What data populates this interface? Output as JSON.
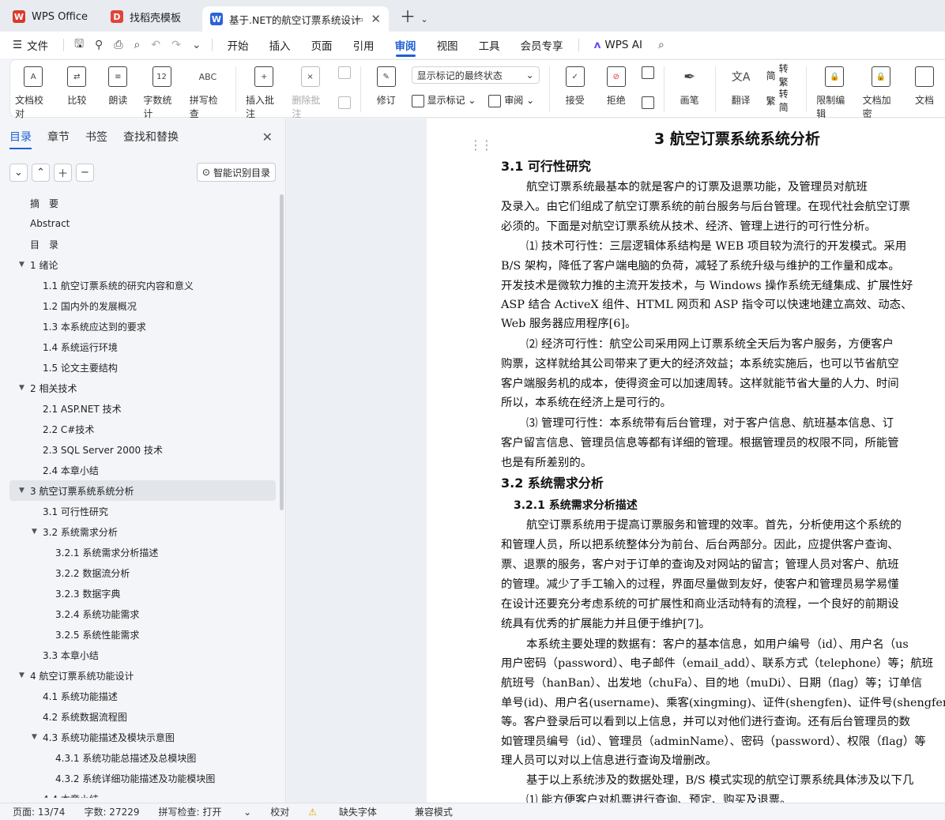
{
  "tabs": [
    {
      "label": "WPS Office",
      "color": "#d93a2b"
    },
    {
      "label": "找稻壳模板",
      "color": "#e0453a"
    },
    {
      "label": "基于.NET的航空订票系统设计",
      "color": "#2b62d9"
    }
  ],
  "menu": {
    "file": "文件",
    "items": [
      "开始",
      "插入",
      "页面",
      "引用",
      "审阅",
      "视图",
      "工具",
      "会员专享"
    ],
    "active": "审阅",
    "ai": "WPS AI"
  },
  "ribbon": {
    "doc_check": "文档校对",
    "compare": "比较",
    "read_aloud": "朗读",
    "word_count": "字数统计",
    "spell_check": "拼写检查",
    "insert_comment": "插入批注",
    "delete_comment": "删除批注",
    "revise": "修订",
    "markup_select": "显示标记的最终状态",
    "show_markup": "显示标记",
    "review": "审阅",
    "accept": "接受",
    "reject": "拒绝",
    "pen": "画笔",
    "translate": "翻译",
    "to_traditional": "转繁",
    "to_simplified": "转简",
    "restrict": "限制编辑",
    "encrypt": "文档加密",
    "doc_more": "文档"
  },
  "nav": {
    "tabs": [
      "目录",
      "章节",
      "书签",
      "查找和替换"
    ],
    "smart_btn": "智能识别目录",
    "toc": [
      {
        "label": "摘　要",
        "level": 0
      },
      {
        "label": "Abstract",
        "level": 0
      },
      {
        "label": "目　录",
        "level": 0
      },
      {
        "label": "1  绪论",
        "level": 0,
        "arrow": true
      },
      {
        "label": "1.1  航空订票系统的研究内容和意义",
        "level": 1
      },
      {
        "label": "1.2  国内外的发展概况",
        "level": 1
      },
      {
        "label": "1.3  本系统应达到的要求",
        "level": 1
      },
      {
        "label": "1.4  系统运行环境",
        "level": 1
      },
      {
        "label": "1.5  论文主要结构",
        "level": 1
      },
      {
        "label": "2  相关技术",
        "level": 0,
        "arrow": true
      },
      {
        "label": "2.1 ASP.NET 技术",
        "level": 1
      },
      {
        "label": "2.2 C#技术",
        "level": 1
      },
      {
        "label": "2.3 SQL Server 2000 技术",
        "level": 1
      },
      {
        "label": "2.4  本章小结",
        "level": 1
      },
      {
        "label": "3  航空订票系统系统分析",
        "level": 0,
        "arrow": true,
        "selected": true
      },
      {
        "label": "3.1  可行性研究",
        "level": 1
      },
      {
        "label": "3.2  系统需求分析",
        "level": 1,
        "arrow": true
      },
      {
        "label": "3.2.1  系统需求分析描述",
        "level": 2
      },
      {
        "label": "3.2.2  数据流分析",
        "level": 2
      },
      {
        "label": "3.2.3  数据字典",
        "level": 2
      },
      {
        "label": "3.2.4  系统功能需求",
        "level": 2
      },
      {
        "label": "3.2.5  系统性能需求",
        "level": 2
      },
      {
        "label": "3.3  本章小结",
        "level": 1
      },
      {
        "label": "4  航空订票系统功能设计",
        "level": 0,
        "arrow": true
      },
      {
        "label": "4.1  系统功能描述",
        "level": 1
      },
      {
        "label": "4.2  系统数据流程图",
        "level": 1
      },
      {
        "label": "4.3  系统功能描述及模块示意图",
        "level": 1,
        "arrow": true
      },
      {
        "label": "4.3.1  系统功能总描述及总模块图",
        "level": 2
      },
      {
        "label": "4.3.2  系统详细功能描述及功能模块图",
        "level": 2
      },
      {
        "label": "4.4  本章小结",
        "level": 1
      }
    ]
  },
  "doc": {
    "lines": [
      {
        "t": "3  航空订票系统系统分析",
        "cls": "h1"
      },
      {
        "t": "3.1  可行性研究",
        "cls": "h2"
      },
      {
        "t": "航空订票系统最基本的就是客户的订票及退票功能，及管理员对航班",
        "cls": "ind"
      },
      {
        "t": "及录入。由它们组成了航空订票系统的前台服务与后台管理。在现代社会航空订票",
        "cls": ""
      },
      {
        "t": "必须的。下面是对航空订票系统从技术、经济、管理上进行的可行性分析。",
        "cls": ""
      },
      {
        "t": "⑴ 技术可行性：三层逻辑体系结构是 WEB 项目较为流行的开发模式。采用",
        "cls": "ind"
      },
      {
        "t": "B/S 架构，降低了客户端电脑的负荷，减轻了系统升级与维护的工作量和成本。",
        "cls": ""
      },
      {
        "t": "开发技术是微软力推的主流开发技术，与 Windows 操作系统无缝集成、扩展性好",
        "cls": ""
      },
      {
        "t": "ASP 结合 ActiveX 组件、HTML 网页和 ASP 指令可以快速地建立高效、动态、",
        "cls": ""
      },
      {
        "t": "Web 服务器应用程序[6]。",
        "cls": ""
      },
      {
        "t": "⑵ 经济可行性：航空公司采用网上订票系统全天后为客户服务，方便客户",
        "cls": "ind"
      },
      {
        "t": "购票，这样就给其公司带来了更大的经济效益；本系统实施后，也可以节省航空",
        "cls": ""
      },
      {
        "t": "客户端服务机的成本，使得资金可以加速周转。这样就能节省大量的人力、时间",
        "cls": ""
      },
      {
        "t": "所以，本系统在经济上是可行的。",
        "cls": ""
      },
      {
        "t": "⑶ 管理可行性：本系统带有后台管理，对于客户信息、航班基本信息、订",
        "cls": "ind"
      },
      {
        "t": "客户留言信息、管理员信息等都有详细的管理。根据管理员的权限不同，所能管",
        "cls": ""
      },
      {
        "t": "也是有所差别的。",
        "cls": ""
      },
      {
        "t": "3.2  系统需求分析",
        "cls": "h2"
      },
      {
        "t": "3.2.1  系统需求分析描述",
        "cls": "h3"
      },
      {
        "t": "航空订票系统用于提高订票服务和管理的效率。首先，分析使用这个系统的",
        "cls": "ind"
      },
      {
        "t": "和管理人员，所以把系统整体分为前台、后台两部分。因此，应提供客户查询、",
        "cls": ""
      },
      {
        "t": "票、退票的服务，客户对于订单的查询及对网站的留言；管理人员对客户、航班",
        "cls": ""
      },
      {
        "t": "的管理。减少了手工输入的过程，界面尽量做到友好，使客户和管理员易学易懂",
        "cls": ""
      },
      {
        "t": "在设计还要充分考虑系统的可扩展性和商业活动特有的流程，一个良好的前期设",
        "cls": ""
      },
      {
        "t": "统具有优秀的扩展能力并且便于维护[7]。",
        "cls": ""
      },
      {
        "t": "本系统主要处理的数据有：客户的基本信息，如用户编号（id）、用户名（us",
        "cls": "ind"
      },
      {
        "t": "用户密码（password）、电子邮件（email_add）、联系方式（telephone）等；航班",
        "cls": ""
      },
      {
        "t": "航班号（hanBan）、出发地（chuFa）、目的地（muDi）、日期（flag）等；订单信",
        "cls": ""
      },
      {
        "t": "单号(id)、用户名(username)、乘客(xingming)、证件(shengfen)、证件号(shengfenz",
        "cls": ""
      },
      {
        "t": "等。客户登录后可以看到以上信息，并可以对他们进行查询。还有后台管理员的数",
        "cls": ""
      },
      {
        "t": "如管理员编号（id）、管理员（adminName）、密码（password）、权限（flag）等",
        "cls": ""
      },
      {
        "t": "理人员可以对以上信息进行查询及增删改。",
        "cls": ""
      },
      {
        "t": "基于以上系统涉及的数据处理，B/S 模式实现的航空订票系统具体涉及以下几",
        "cls": "ind"
      },
      {
        "t": "⑴ 能方便客户对机票进行查询、预定、购买及退票。",
        "cls": "ind"
      }
    ]
  },
  "status": {
    "page": "页面: 13/74",
    "words": "字数: 27229",
    "spell": "拼写检查: 打开",
    "proof": "校对",
    "missing_font": "缺失字体",
    "compat": "兼容模式"
  }
}
